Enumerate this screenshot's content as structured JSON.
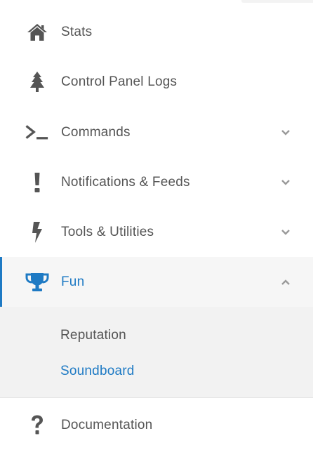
{
  "nav": {
    "items": [
      {
        "label": "Stats",
        "icon": "home-icon"
      },
      {
        "label": "Control Panel Logs",
        "icon": "tree-icon"
      },
      {
        "label": "Commands",
        "icon": "terminal-icon",
        "expandable": true
      },
      {
        "label": "Notifications & Feeds",
        "icon": "exclamation-icon",
        "expandable": true
      },
      {
        "label": "Tools & Utilities",
        "icon": "bolt-icon",
        "expandable": true
      },
      {
        "label": "Fun",
        "icon": "trophy-icon",
        "expandable": true,
        "expanded": true,
        "active": true
      },
      {
        "label": "Documentation",
        "icon": "question-icon"
      }
    ],
    "fun_submenu": [
      {
        "label": "Reputation",
        "active": false
      },
      {
        "label": "Soundboard",
        "active": true
      }
    ]
  },
  "colors": {
    "accent": "#1e7ac4",
    "text": "#555555",
    "icon": "#555555",
    "chevron": "#9a9a9a",
    "active_bg": "#f6f6f6",
    "submenu_bg": "#f2f2f2"
  }
}
